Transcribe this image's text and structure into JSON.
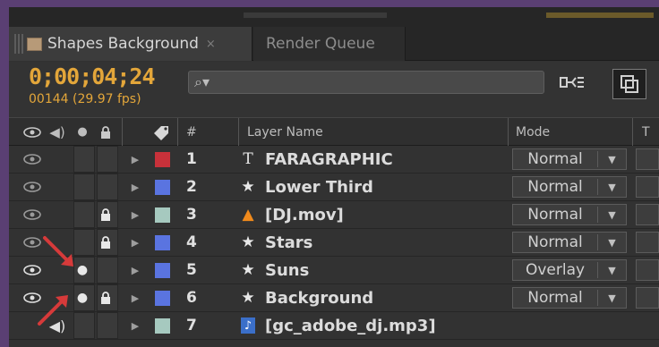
{
  "tabs": [
    {
      "label": "Shapes Background",
      "active": true,
      "close": "×"
    },
    {
      "label": "Render Queue",
      "active": false
    }
  ],
  "header": {
    "timecode": "0;00;04;24",
    "frame_fps": "00144 (29.97 fps)",
    "search_glyph": "⌕▾",
    "search_placeholder": ""
  },
  "columns": {
    "hash": "#",
    "layer_name": "Layer Name",
    "mode": "Mode",
    "t": "T"
  },
  "layers": [
    {
      "num": "1",
      "type_glyph": "T",
      "type_icon": "text-layer-icon",
      "name": "FARAGRAPHIC",
      "mode": "Normal",
      "color": "#c8313a",
      "eye": true,
      "audio": false,
      "solo": false,
      "lock": false
    },
    {
      "num": "2",
      "type_glyph": "★",
      "type_icon": "shape-layer-icon",
      "name": "Lower Third",
      "mode": "Normal",
      "color": "#5a74e0",
      "eye": true,
      "audio": false,
      "solo": false,
      "lock": false
    },
    {
      "num": "3",
      "type_glyph": "▲",
      "type_icon": "vlc-footage-icon",
      "name": "[DJ.mov]",
      "mode": "Normal",
      "color": "#a6c9bf",
      "eye": true,
      "audio": false,
      "solo": false,
      "lock": true
    },
    {
      "num": "4",
      "type_glyph": "★",
      "type_icon": "shape-layer-icon",
      "name": "Stars",
      "mode": "Normal",
      "color": "#5a74e0",
      "eye": true,
      "audio": false,
      "solo": false,
      "lock": true
    },
    {
      "num": "5",
      "type_glyph": "★",
      "type_icon": "shape-layer-icon",
      "name": "Suns",
      "mode": "Overlay",
      "color": "#5a74e0",
      "eye": true,
      "audio": false,
      "solo": true,
      "lock": false
    },
    {
      "num": "6",
      "type_glyph": "★",
      "type_icon": "shape-layer-icon",
      "name": "Background",
      "mode": "Normal",
      "color": "#5a74e0",
      "eye": true,
      "audio": false,
      "solo": true,
      "lock": true
    },
    {
      "num": "7",
      "type_glyph": "♪",
      "type_icon": "audio-file-icon",
      "name": "[gc_adobe_dj.mp3]",
      "mode": "",
      "color": "#a6c9bf",
      "eye": false,
      "audio": true,
      "solo": false,
      "lock": false
    }
  ],
  "colors": {
    "timecode": "#e3a63a",
    "annotation_arrow": "#d63a3a"
  }
}
